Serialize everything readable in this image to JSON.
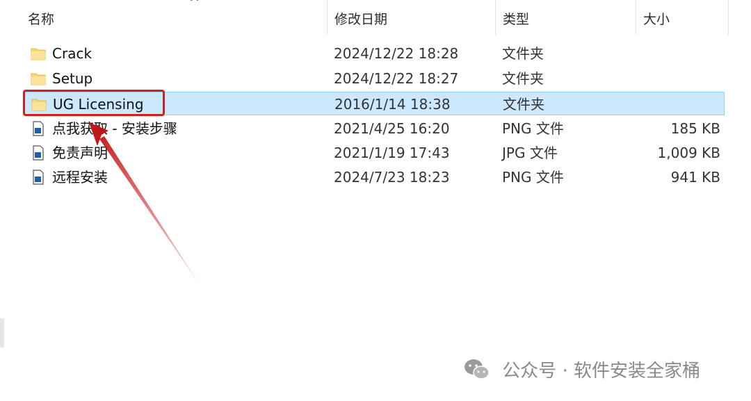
{
  "header": {
    "name_label": "名称",
    "date_label": "修改日期",
    "type_label": "类型",
    "size_label": "大小",
    "sort_indicator": "^"
  },
  "files": [
    {
      "name": "Crack",
      "date": "2024/12/22 18:28",
      "type": "文件夹",
      "size": "",
      "icon": "folder-icon"
    },
    {
      "name": "Setup",
      "date": "2024/12/22 18:27",
      "type": "文件夹",
      "size": "",
      "icon": "folder-icon"
    },
    {
      "name": "UG Licensing",
      "date": "2016/1/14 18:38",
      "type": "文件夹",
      "size": "",
      "icon": "folder-icon",
      "selected": true
    },
    {
      "name": "点我获取 - 安装步骤",
      "date": "2021/4/25 16:20",
      "type": "PNG 文件",
      "size": "185 KB",
      "icon": "image-file-icon"
    },
    {
      "name": "免责声明",
      "date": "2021/1/19 17:43",
      "type": "JPG 文件",
      "size": "1,009 KB",
      "icon": "image-file-icon"
    },
    {
      "name": "远程安装",
      "date": "2024/7/23 18:23",
      "type": "PNG 文件",
      "size": "941 KB",
      "icon": "image-file-icon"
    }
  ],
  "watermark": {
    "text": "公众号 · 软件安装全家桶",
    "icon": "wechat-icon"
  },
  "colors": {
    "selection_bg": "#cce8ff",
    "selection_border": "#99d1ff",
    "annotation_red": "#d11f1f",
    "folder_yellow": "#f8d775"
  }
}
